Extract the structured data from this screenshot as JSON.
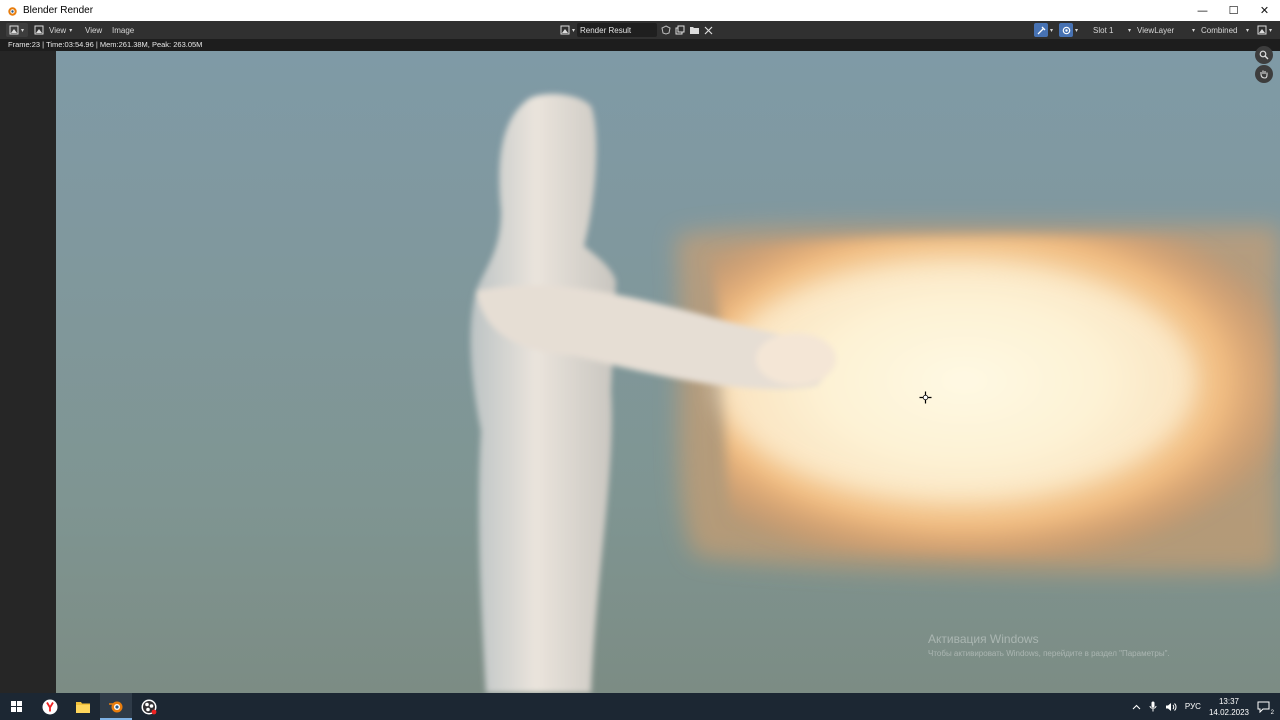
{
  "window": {
    "title": "Blender Render",
    "minimize_glyph": "—",
    "maximize_glyph": "☐",
    "close_glyph": "✕"
  },
  "header": {
    "view_btn": "View",
    "menus": [
      "View",
      "Image"
    ],
    "image_name": "Render Result",
    "slot": "Slot 1",
    "view_layer": "ViewLayer",
    "pass": "Combined"
  },
  "info": {
    "text": "Frame:23 | Time:03:54.96 | Mem:261.38M, Peak: 263.05M"
  },
  "activation": {
    "line1": "Активация Windows",
    "line2": "Чтобы активировать Windows, перейдите в раздел \"Параметры\"."
  },
  "taskbar": {
    "lang": "РУС",
    "time": "13:37",
    "date": "14.02.2023",
    "notifications": "2",
    "apps": [
      "windows-start",
      "yandex-browser",
      "file-explorer",
      "blender",
      "obs-studio"
    ]
  },
  "colors": {
    "accent": "#4772b3",
    "header_bg": "#303030",
    "taskbar_bg": "#1c2733"
  }
}
